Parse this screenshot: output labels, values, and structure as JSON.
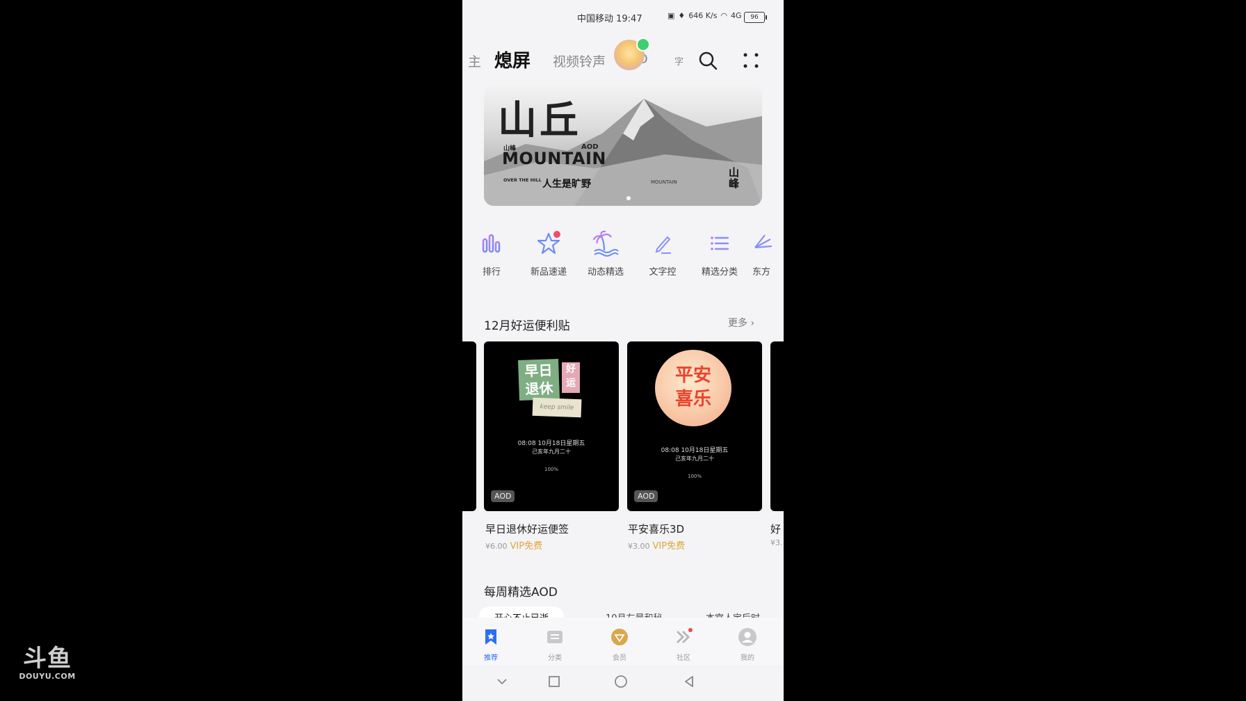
{
  "watermark": {
    "logo": "斗鱼",
    "domain": "DOUYU.COM"
  },
  "status_bar": {
    "carrier_time": "中国移动 19:47",
    "net_speed": "646 K/s",
    "signal": "4G",
    "battery": "96"
  },
  "top_tabs": [
    {
      "label": "主"
    },
    {
      "label": "熄屏"
    },
    {
      "label": "视频铃声"
    },
    {
      "label": "3D"
    },
    {
      "label": "字"
    }
  ],
  "banner": {
    "title_cn": "山丘",
    "small_label": "山峰",
    "aod": "AOD",
    "title_en": "MOUNTAIN",
    "over_the_hill": "OVER THE HILL",
    "slogan": "人生是旷野",
    "mountain_small": "MOUNTAIN",
    "peak": "山峰"
  },
  "categories": [
    {
      "label": "排行",
      "icon": "bar-chart-icon"
    },
    {
      "label": "新品速递",
      "icon": "star-icon",
      "badge": "NEW"
    },
    {
      "label": "动态精选",
      "icon": "palm-tree-icon"
    },
    {
      "label": "文字控",
      "icon": "pen-icon"
    },
    {
      "label": "精选分类",
      "icon": "list-icon"
    },
    {
      "label": "东方",
      "icon": "fan-icon"
    }
  ],
  "section1": {
    "title": "12月好运便利贴",
    "more": "更多"
  },
  "cards": [
    {
      "title": "早日退休好运便签",
      "price": "¥6.00",
      "vip": "VIP免费",
      "badge": "AOD",
      "art_line1": "早日",
      "art_line2": "退休",
      "art_tag": "好运",
      "art_note": "keep smile",
      "time": "08:08  10月18日星期五",
      "lunar": "己亥年九月二十",
      "battery": "100%"
    },
    {
      "title": "平安喜乐3D",
      "price": "¥3.00",
      "vip": "VIP免费",
      "badge": "AOD",
      "art_line1": "平安",
      "art_line2": "喜乐",
      "time": "08:08  10月18日星期五",
      "lunar": "己亥年九月二十",
      "battery": "100%"
    },
    {
      "title": "好",
      "price": "¥3."
    }
  ],
  "section2": {
    "title": "每周精选AOD",
    "pills": [
      "开心不止已逝",
      "10月左是和秘",
      "本宫人宝后时"
    ]
  },
  "bottom_nav": [
    {
      "label": "推荐",
      "icon": "bookmark-icon",
      "active": true
    },
    {
      "label": "分类",
      "icon": "category-icon"
    },
    {
      "label": "会员",
      "icon": "vip-icon"
    },
    {
      "label": "社区",
      "icon": "community-icon"
    },
    {
      "label": "我的",
      "icon": "profile-icon"
    }
  ],
  "colors": {
    "accent": "#2c6df5",
    "vip_gold": "#e0a43a",
    "background": "#f4f4f6",
    "page_bg": "#000000"
  }
}
